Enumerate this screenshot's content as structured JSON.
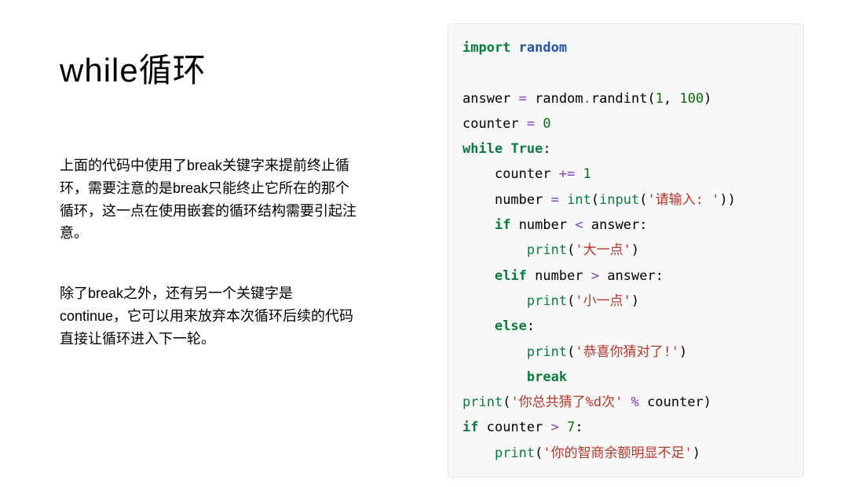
{
  "heading": "while循环",
  "paragraph1": "上面的代码中使用了break关键字来提前终止循环，需要注意的是break只能终止它所在的那个循环，这一点在使用嵌套的循环结构需要引起注意。",
  "paragraph2": "除了break之外，还有另一个关键字是continue，它可以用来放弃本次循环后续的代码直接让循环进入下一轮。",
  "code": {
    "l01_import": "import",
    "l01_random": "random",
    "l03_answer": "answer",
    "l03_eq": "=",
    "l03_random": "random",
    "l03_dot": ".",
    "l03_randint": "randint",
    "l03_lp": "(",
    "l03_n1": "1",
    "l03_comma": ",",
    "l03_n2": "100",
    "l03_rp": ")",
    "l04_counter": "counter",
    "l04_eq": "=",
    "l04_zero": "0",
    "l05_while": "while",
    "l05_true": "True",
    "l05_colon": ":",
    "l06_counter": "counter",
    "l06_pluseq": "+=",
    "l06_one": "1",
    "l07_number": "number",
    "l07_eq": "=",
    "l07_int": "int",
    "l07_lp": "(",
    "l07_input": "input",
    "l07_lp2": "(",
    "l07_str": "'请输入: '",
    "l07_rp2": ")",
    "l07_rp": ")",
    "l08_if": "if",
    "l08_number": "number",
    "l08_lt": "<",
    "l08_answer": "answer",
    "l08_colon": ":",
    "l09_print": "print",
    "l09_lp": "(",
    "l09_str": "'大一点'",
    "l09_rp": ")",
    "l10_elif": "elif",
    "l10_number": "number",
    "l10_gt": ">",
    "l10_answer": "answer",
    "l10_colon": ":",
    "l11_print": "print",
    "l11_lp": "(",
    "l11_str": "'小一点'",
    "l11_rp": ")",
    "l12_else": "else",
    "l12_colon": ":",
    "l13_print": "print",
    "l13_lp": "(",
    "l13_str": "'恭喜你猜对了!'",
    "l13_rp": ")",
    "l14_break": "break",
    "l15_print": "print",
    "l15_lp": "(",
    "l15_str": "'你总共猜了%d次'",
    "l15_pct": "%",
    "l15_counter": "counter",
    "l15_rp": ")",
    "l16_if": "if",
    "l16_counter": "counter",
    "l16_gt": ">",
    "l16_seven": "7",
    "l16_colon": ":",
    "l17_print": "print",
    "l17_lp": "(",
    "l17_str": "'你的智商余额明显不足'",
    "l17_rp": ")"
  }
}
